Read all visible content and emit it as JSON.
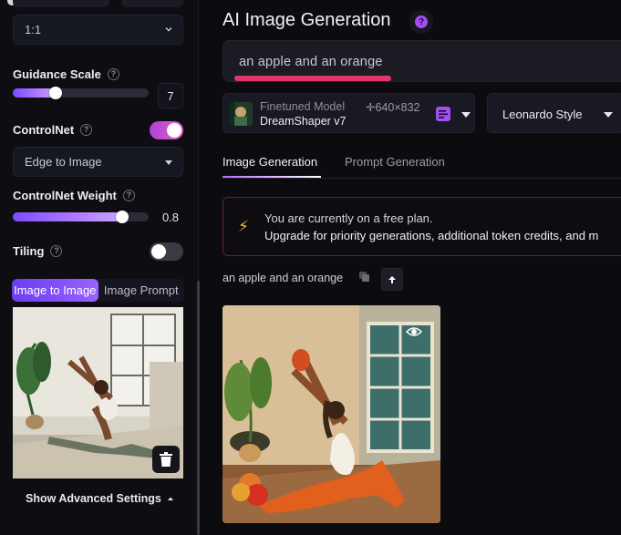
{
  "sidebar": {
    "aspect_ratio": {
      "value": "1:1"
    },
    "guidance_scale": {
      "label": "Guidance Scale",
      "value": "7",
      "fraction": 0.31
    },
    "controlnet": {
      "label": "ControlNet",
      "enabled": true,
      "mode": "Edge to Image"
    },
    "controlnet_weight": {
      "label": "ControlNet Weight",
      "value": "0.8",
      "fraction": 0.8
    },
    "tiling": {
      "label": "Tiling",
      "enabled": false
    },
    "image_tabs": [
      "Image to Image",
      "Image Prompt"
    ],
    "show_advanced": "Show Advanced Settings"
  },
  "main": {
    "title": "AI Image Generation",
    "prompt": "an apple and an orange",
    "model": {
      "caption": "Finetuned Model",
      "name": "DreamShaper v7",
      "resolution": "✛640×832"
    },
    "style": "Leonardo Style",
    "tabs": [
      "Image Generation",
      "Prompt Generation"
    ],
    "banner": {
      "line1": "You are currently on a free plan.",
      "line2": "Upgrade for priority generations, additional token credits, and m"
    },
    "generation_prompt": "an apple and an orange"
  },
  "colors": {
    "accent_purple": "#9a62ff",
    "accent_pink": "#e2356b",
    "warning_yellow": "#f0c020"
  }
}
